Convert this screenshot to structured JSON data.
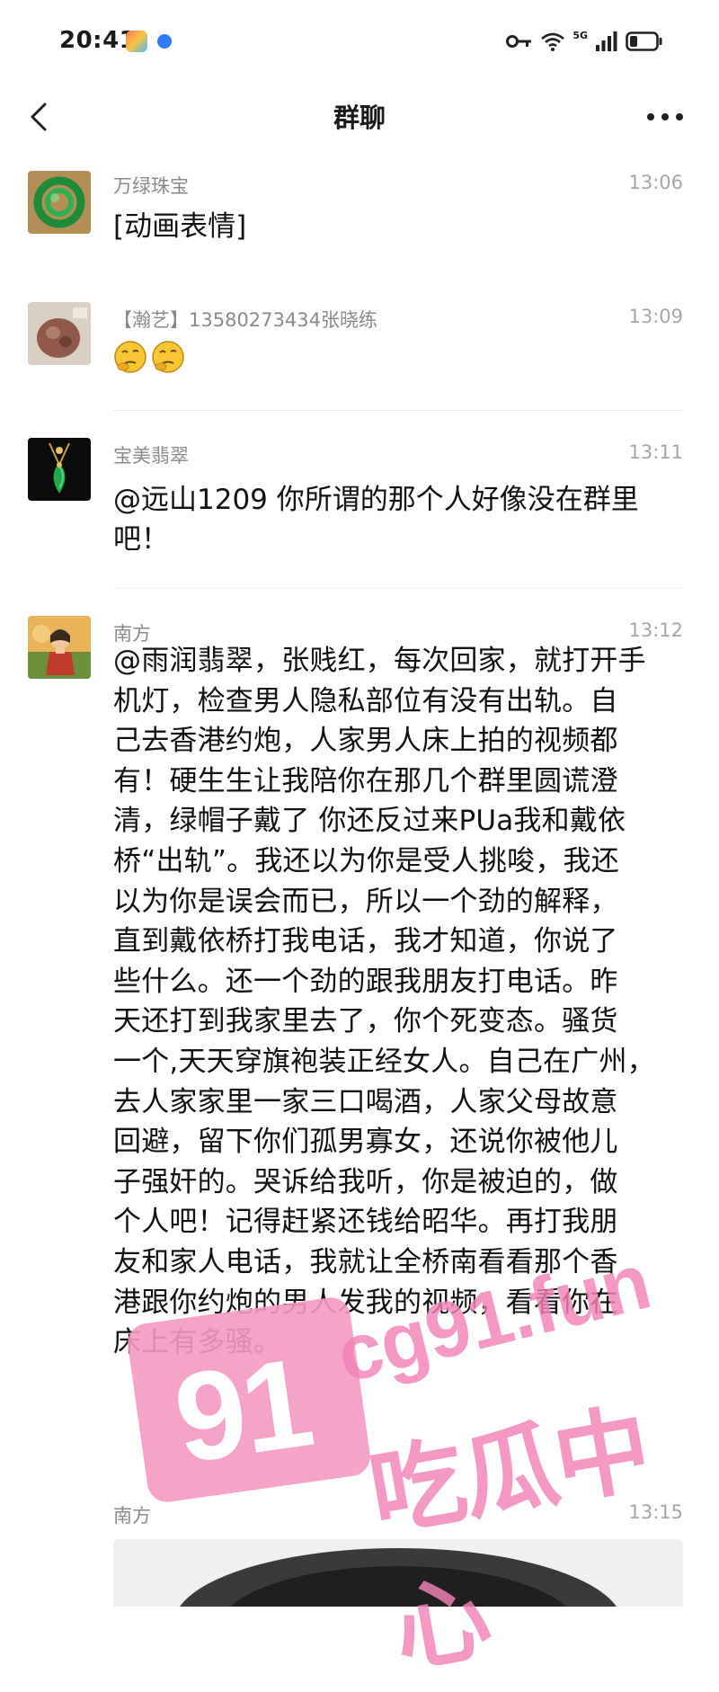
{
  "status_bar": {
    "time": "20:41",
    "icons": [
      "app-notification-icon",
      "blue-dot-icon",
      "key-icon",
      "wifi-icon",
      "signal-icon",
      "battery-icon"
    ],
    "network": "5G"
  },
  "nav": {
    "title": "群聊",
    "back_icon": "chevron-left-icon",
    "more_icon": "more-dots-icon"
  },
  "messages": [
    {
      "sender": "万绿珠宝",
      "time": "13:06",
      "text": "[动画表情]"
    },
    {
      "sender": "【瀚艺】13580273434张晓练",
      "time": "13:09",
      "text": "🤔🤔"
    },
    {
      "sender": "宝美翡翠",
      "time": "13:11",
      "text": "@远山1209 你所谓的那个人好像没在群里吧！"
    },
    {
      "sender": "南方",
      "time": "13:12",
      "lines": [
        "@雨润翡翠，张贱红，每次回家，就打开手",
        "机灯，检查男人隐私部位有没有出轨。自",
        "己去香港约炮，人家男人床上拍的视频都",
        "有！硬生生让我陪你在那几个群里圆谎澄",
        "清，绿帽子戴了 你还反过来PUa我和戴依",
        "桥“出轨”。我还以为你是受人挑唆，我还",
        "以为你是误会而已，所以一个劲的解释，",
        "直到戴依桥打我电话，我才知道，你说了",
        "些什么。还一个劲的跟我朋友打电话。昨",
        "天还打到我家里去了，你个死变态。骚货",
        "一个,天天穿旗袍装正经女人。自己在广州，",
        "去人家家里一家三口喝酒，人家父母故意",
        "回避，留下你们孤男寡女，还说你被他儿",
        "子强奸的。哭诉给我听，你是被迫的，做",
        "个人吧！记得赶紧还钱给昭华。再打我朋",
        "友和家人电话，我就让全桥南看看那个香",
        "港跟你约炮的男人发我的视频，看看你在",
        "床上有多骚。"
      ]
    },
    {
      "sender": "南方",
      "time": "13:15",
      "text": ""
    }
  ],
  "watermark": {
    "badge": "91",
    "url": "cg91.fun",
    "label": "吃瓜中心"
  },
  "colors": {
    "sender_gray": "#8a8a8a",
    "time_gray": "#a6a6a6",
    "watermark_pink": "#f183b6"
  }
}
